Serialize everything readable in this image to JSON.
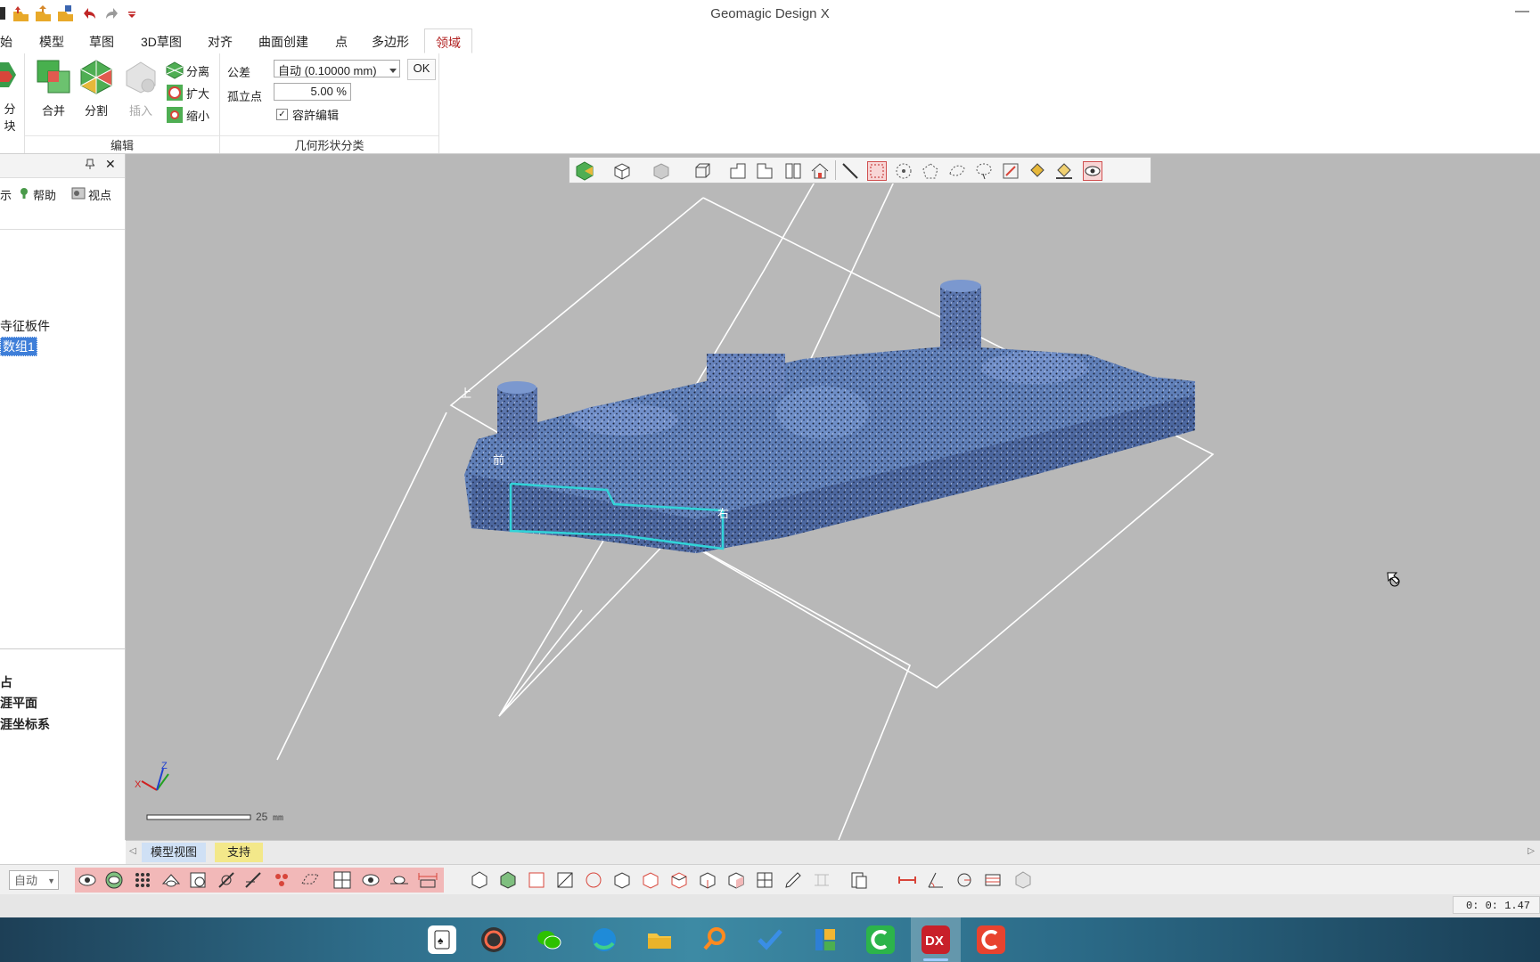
{
  "window": {
    "title": "Geomagic Design X",
    "minimize_symbol": "—"
  },
  "ribbon": {
    "tabs": [
      "始",
      "模型",
      "草图",
      "3D草图",
      "对齐",
      "曲面创建",
      "点",
      "多边形",
      "领域"
    ],
    "active_tab": "领域",
    "groups": {
      "edit_label": "编辑",
      "geometry_label": "几何形状分类"
    },
    "buttons": {
      "split_block": "分块",
      "merge": "合并",
      "divide": "分割",
      "insert": "插入",
      "separate": "分离",
      "expand": "扩大",
      "shrink": "缩小"
    },
    "tolerance_label": "公差",
    "tolerance_value": "自动 (0.10000 mm)",
    "ok_label": "OK",
    "isolated_label": "孤立点",
    "isolated_value": "5.00 %",
    "allow_edit_label": "容許编辑",
    "allow_edit_checked": true
  },
  "left_panel": {
    "toolbar_display": "示",
    "help_label": "帮助",
    "viewpoint_label": "视点",
    "tree_item_1": "寺征板件",
    "tree_item_2_selected": "数组1",
    "lower_item_1": "占",
    "lower_item_2": "涯平面",
    "lower_item_3": "涯坐标系"
  },
  "viewport": {
    "axis_label_top": "上",
    "axis_label_front": "前",
    "axis_label_right": "右",
    "scale_value": "25",
    "scale_unit": "mm",
    "triad_x": "X",
    "triad_z": "Z",
    "model_color": "#5f7fb8",
    "highlight_color": "#32d3d8"
  },
  "view_tabs": {
    "model_view": "模型视图",
    "support": "支持"
  },
  "bottom": {
    "mode_value": "自动",
    "status_time": "0: 0: 1.47"
  }
}
